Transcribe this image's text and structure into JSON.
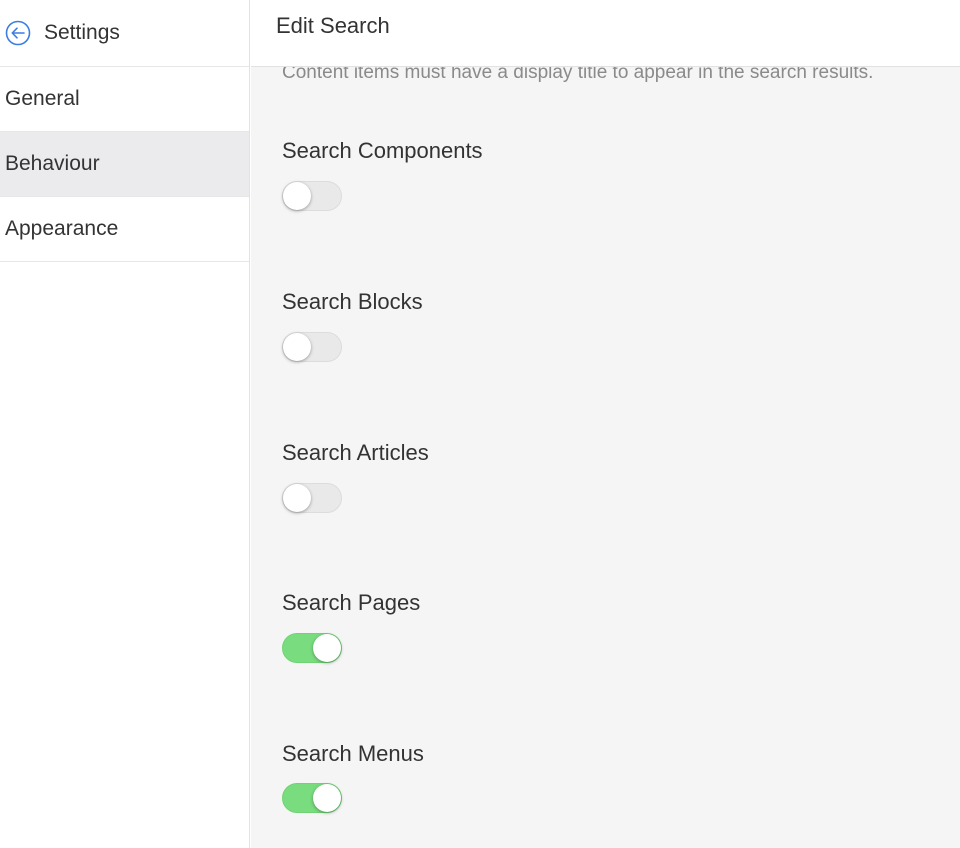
{
  "sidebar": {
    "back_icon": "arrow-left-circle-icon",
    "title": "Settings",
    "items": [
      {
        "label": "General",
        "active": false
      },
      {
        "label": "Behaviour",
        "active": true
      },
      {
        "label": "Appearance",
        "active": false
      }
    ]
  },
  "main": {
    "title": "Edit Search",
    "notice": "Content items must have a display title to appear in the search results.",
    "settings": [
      {
        "label": "Search Components",
        "enabled": false
      },
      {
        "label": "Search Blocks",
        "enabled": false
      },
      {
        "label": "Search Articles",
        "enabled": false
      },
      {
        "label": "Search Pages",
        "enabled": true
      },
      {
        "label": "Search Menus",
        "enabled": true
      }
    ]
  },
  "colors": {
    "accent_blue": "#3b7de0",
    "toggle_on": "#79dc7f",
    "toggle_off": "#e9e9e9",
    "active_nav_bg": "#ebebee"
  }
}
